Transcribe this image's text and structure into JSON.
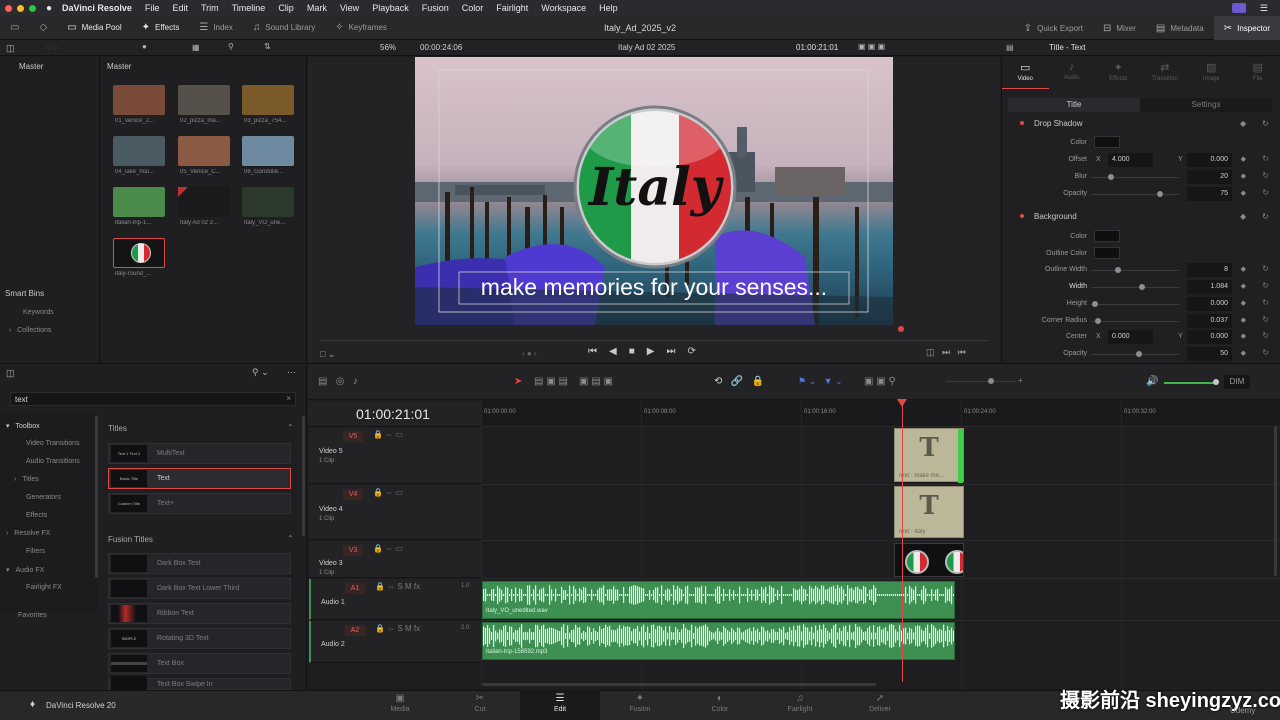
{
  "menubar": {
    "app": "DaVinci Resolve",
    "items": [
      "File",
      "Edit",
      "Trim",
      "Timeline",
      "Clip",
      "Mark",
      "View",
      "Playback",
      "Fusion",
      "Color",
      "Fairlight",
      "Workspace",
      "Help"
    ]
  },
  "toolbar": {
    "left": [
      {
        "label": "Media Pool",
        "icon": "media-pool-icon",
        "on": true
      },
      {
        "label": "Effects",
        "icon": "effects-icon",
        "on": true
      },
      {
        "label": "Index",
        "icon": "index-icon",
        "on": false
      },
      {
        "label": "Sound Library",
        "icon": "sound-library-icon",
        "on": false
      },
      {
        "label": "Keyframes",
        "icon": "keyframes-icon",
        "on": false
      }
    ],
    "project_title": "Italy_Ad_2025_v2",
    "right": [
      {
        "label": "Quick Export",
        "icon": "quick-export-icon",
        "on": false
      },
      {
        "label": "Mixer",
        "icon": "mixer-icon",
        "on": false
      },
      {
        "label": "Metadata",
        "icon": "metadata-icon",
        "on": false
      },
      {
        "label": "Inspector",
        "icon": "inspector-icon",
        "on": true
      }
    ]
  },
  "viewer_bar": {
    "zoom": "56%",
    "source_tc": "00:00:24:06",
    "timeline_name": "Italy Ad 02 2025",
    "record_tc": "01:00:21:01",
    "inspector_title": "Title - Text"
  },
  "media_pool": {
    "tree_header": "Master",
    "bin_header": "Master",
    "clips": [
      {
        "label": "01_venice_2...",
        "bg": "#7a4a38"
      },
      {
        "label": "02_pizza_ma...",
        "bg": "#55504a"
      },
      {
        "label": "03_pizza_754...",
        "bg": "#7a5a28"
      },
      {
        "label": "04_lake_hou...",
        "bg": "#4a5a62"
      },
      {
        "label": "05_Venice_C...",
        "bg": "#8a5a44"
      },
      {
        "label": "06_Gondolie...",
        "bg": "#6e8aa0"
      },
      {
        "label": "italian-trip-1...",
        "bg": "#4a8a4a"
      },
      {
        "label": "Italy Ad 02 2...",
        "bg": "#1a1a1c"
      },
      {
        "label": "Italy_VO_une...",
        "bg": "#2c3a2c"
      },
      {
        "label": "italy-round_...",
        "bg": "#141416"
      }
    ],
    "smart_bins": "Smart Bins",
    "smart_items": [
      "Keywords",
      "Collections"
    ]
  },
  "viewer": {
    "logo_text": "Italy",
    "subtitle": "make memories for your senses..."
  },
  "effects": {
    "search_value": "text",
    "nav": [
      {
        "label": "Toolbox",
        "level": 0,
        "arrow": "▾",
        "bold": true
      },
      {
        "label": "Video Transitions",
        "level": 1
      },
      {
        "label": "Audio Transitions",
        "level": 1
      },
      {
        "label": "Titles",
        "level": 1,
        "arrow": "›"
      },
      {
        "label": "Generators",
        "level": 1
      },
      {
        "label": "Effects",
        "level": 1
      },
      {
        "label": "Resolve FX",
        "level": 0,
        "arrow": "›"
      },
      {
        "label": "Filters",
        "level": 1
      },
      {
        "label": "Audio FX",
        "level": 0,
        "arrow": "▾"
      },
      {
        "label": "Fairlight FX",
        "level": 1
      }
    ],
    "favorites": "Favorites",
    "titles_header": "Titles",
    "titles": [
      {
        "thumb": "Text 1 Text 2",
        "label": "MultiText",
        "selected": false
      },
      {
        "thumb": "Basic Title",
        "label": "Text",
        "selected": true
      },
      {
        "thumb": "Custom Title",
        "label": "Text+",
        "selected": false
      }
    ],
    "fusion_header": "Fusion Titles",
    "fusion": [
      {
        "thumb": "",
        "label": "Dark Box Text"
      },
      {
        "thumb": "",
        "label": "Dark Box Text Lower Third"
      },
      {
        "thumb": "",
        "label": "Ribbon Text"
      },
      {
        "thumb": "SIMPLE",
        "label": "Rotating 3D Text"
      },
      {
        "thumb": "",
        "label": "Text Box"
      },
      {
        "thumb": "",
        "label": "Text Box Swipe In"
      }
    ]
  },
  "inspector": {
    "tabs": [
      {
        "label": "Video",
        "icon": "video-tab-icon",
        "on": true
      },
      {
        "label": "Audio",
        "icon": "audio-tab-icon",
        "on": false
      },
      {
        "label": "Effects",
        "icon": "effects-tab-icon",
        "on": false
      },
      {
        "label": "Transition",
        "icon": "transition-tab-icon",
        "on": false
      },
      {
        "label": "Image",
        "icon": "image-tab-icon",
        "on": false
      },
      {
        "label": "File",
        "icon": "file-tab-icon",
        "on": false
      }
    ],
    "subtabs": [
      "Title",
      "Settings"
    ],
    "drop_shadow": "Drop Shadow",
    "background": "Background",
    "ds_color": "Color",
    "ds_offset": "Offset",
    "ds_offset_x": "4.000",
    "ds_offset_y": "0.000",
    "ds_blur": "Blur",
    "ds_blur_val": "20",
    "ds_opacity": "Opacity",
    "ds_opacity_val": "75",
    "bg_color": "Color",
    "bg_outline_color": "Outline Color",
    "bg_outline_width": "Outline Width",
    "bg_outline_width_val": "8",
    "bg_width": "Width",
    "bg_width_val": "1.084",
    "bg_height": "Height",
    "bg_height_val": "0.000",
    "bg_corner": "Corner Radius",
    "bg_corner_val": "0.037",
    "bg_center": "Center",
    "bg_center_x": "0.000",
    "bg_center_y": "0.000",
    "bg_opacity": "Opacity",
    "bg_opacity_val": "50",
    "x": "X",
    "y": "Y"
  },
  "timeline": {
    "timecode": "01:00:21:01",
    "ruler": [
      "01:00:00:00",
      "01:00:08:00",
      "01:00:16:00",
      "01:00:24:00",
      "01:00:32:00"
    ],
    "tracks": [
      {
        "badge": "V5",
        "name": "Video 5",
        "clips": "1 Clip"
      },
      {
        "badge": "V4",
        "name": "Video 4",
        "clips": "1 Clip"
      },
      {
        "badge": "V3",
        "name": "Video 3",
        "clips": "1 Clip"
      },
      {
        "badge": "A1",
        "name": "Audio 1",
        "level": "1.0"
      },
      {
        "badge": "A2",
        "name": "Audio 2",
        "level": "2.0"
      }
    ],
    "clip_v5": "Text - make me...",
    "clip_v4": "Text - Italy",
    "clip_a1": "Italy_VO_unedited.wav",
    "clip_a2": "italian-trip-158592.mp3",
    "dim": "DIM"
  },
  "footer": {
    "brand": "DaVinci Resolve 20",
    "pages": [
      {
        "label": "Media",
        "icon": "media-page-icon"
      },
      {
        "label": "Cut",
        "icon": "cut-page-icon"
      },
      {
        "label": "Edit",
        "icon": "edit-page-icon",
        "on": true
      },
      {
        "label": "Fusion",
        "icon": "fusion-page-icon"
      },
      {
        "label": "Color",
        "icon": "color-page-icon"
      },
      {
        "label": "Fairlight",
        "icon": "fairlight-page-icon"
      },
      {
        "label": "Deliver",
        "icon": "deliver-page-icon"
      }
    ],
    "watermark": "摄影前沿 sheyingzyz.com",
    "watermark2": "Udemy"
  },
  "colors": {
    "accent_red": "#e04848",
    "audio_green": "#3d8f52",
    "title_clip": "#bdb79a"
  }
}
